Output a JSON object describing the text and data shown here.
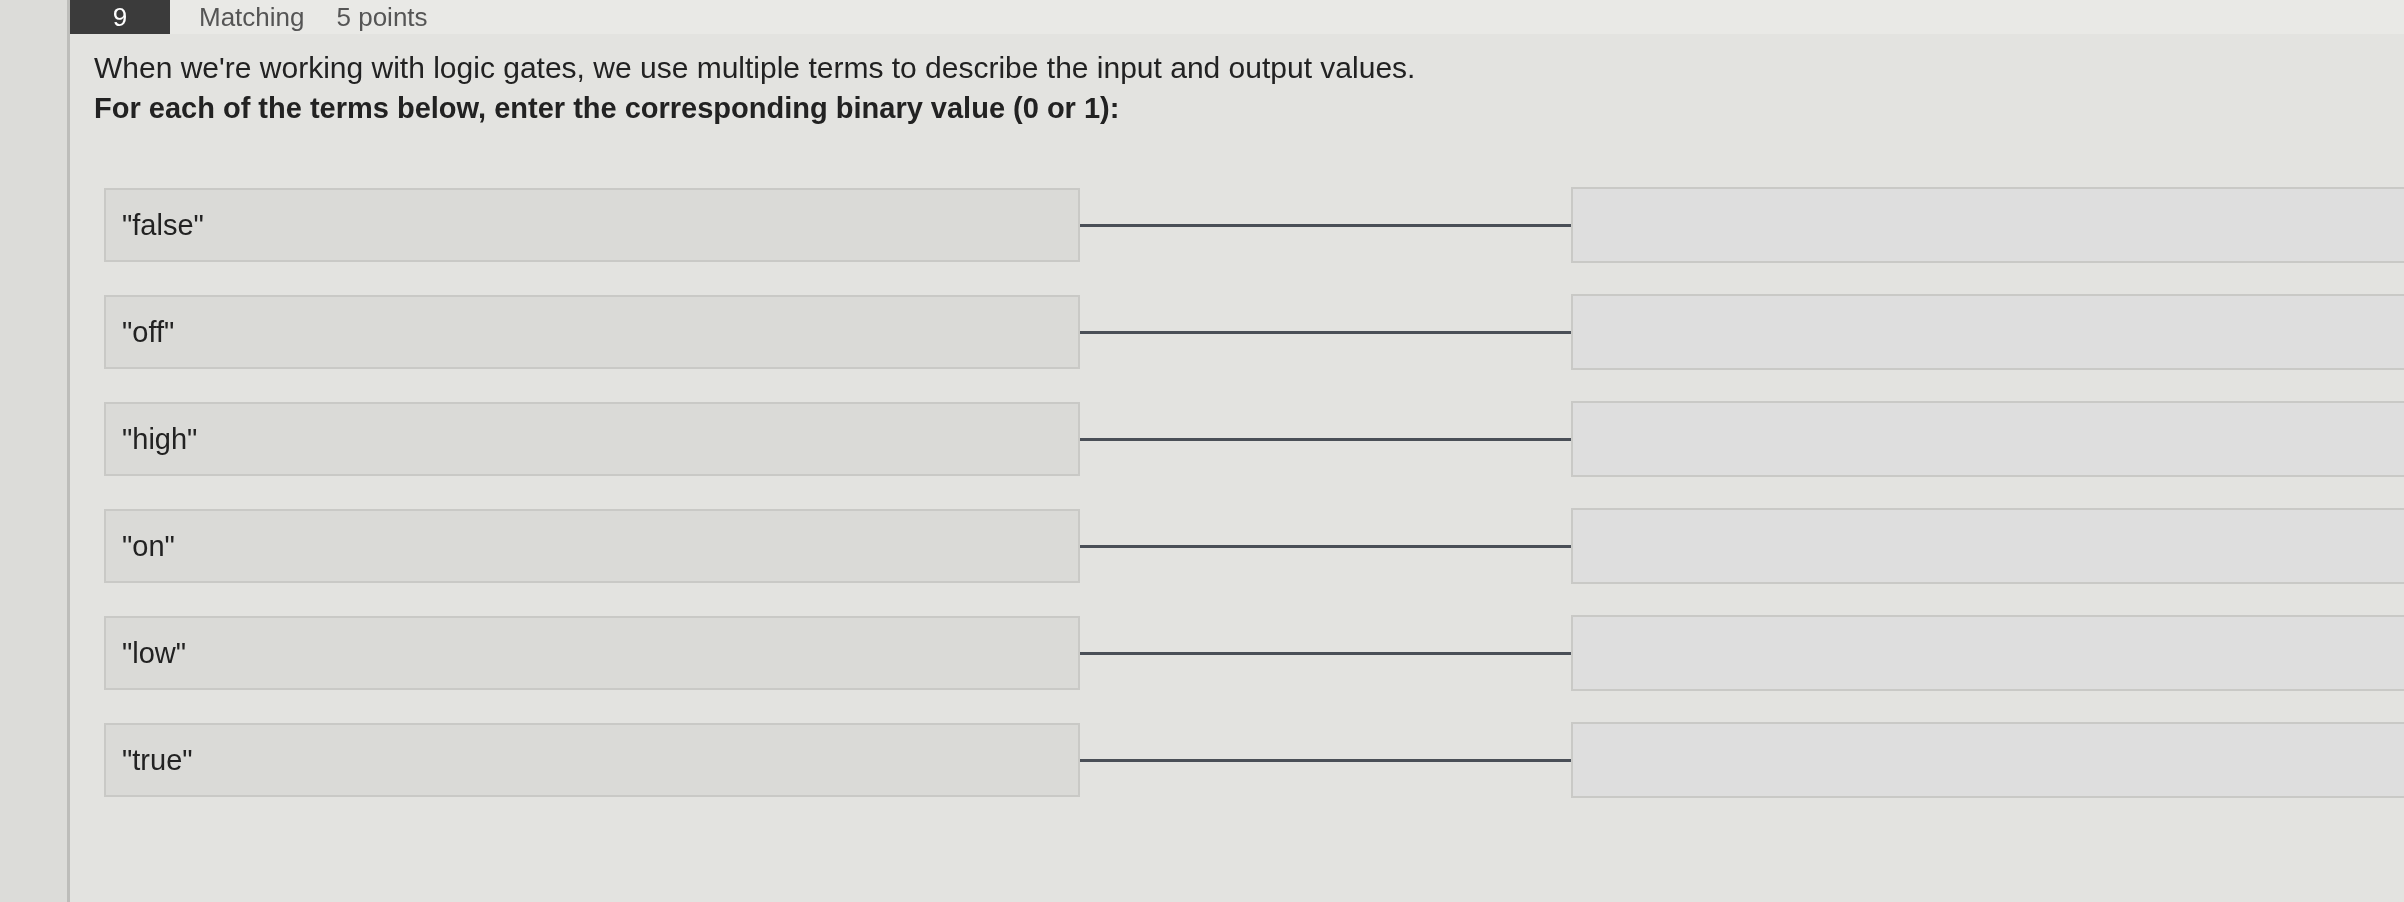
{
  "question": {
    "number": "9",
    "type": "Matching",
    "points": "5 points",
    "prompt": "When we're working with logic gates, we use multiple terms to describe the input and output values.",
    "instruction": "For each of the terms below, enter the corresponding binary value (0 or 1):"
  },
  "pairs": [
    {
      "term": "\"false\""
    },
    {
      "term": "\"off\""
    },
    {
      "term": "\"high\""
    },
    {
      "term": "\"on\""
    },
    {
      "term": "\"low\""
    },
    {
      "term": "\"true\""
    }
  ]
}
